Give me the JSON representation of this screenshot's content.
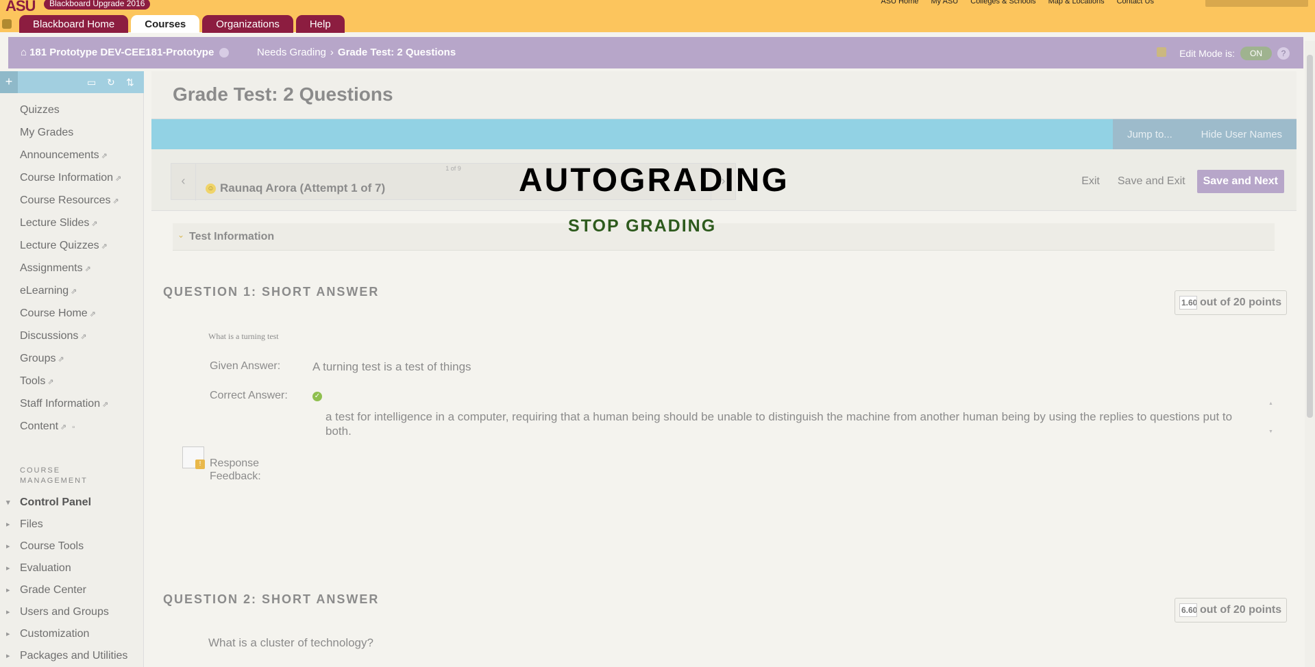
{
  "topbar": {
    "logo": "ASU",
    "badge": "Blackboard Upgrade 2016",
    "links": [
      "ASU Home",
      "My ASU",
      "Colleges & Schools",
      "Map & Locations",
      "Contact Us"
    ],
    "tabs": [
      "Blackboard Home",
      "Courses",
      "Organizations",
      "Help"
    ]
  },
  "coursebar": {
    "course": "181 Prototype DEV-CEE181-Prototype",
    "crumb1": "Needs Grading",
    "crumb_sep": "›",
    "crumb2": "Grade Test: 2 Questions",
    "edit_label": "Edit Mode is:",
    "edit_state": "ON",
    "help": "?"
  },
  "sidebar": {
    "items": [
      "Quizzes",
      "My Grades",
      "Announcements",
      "Course Information",
      "Course Resources",
      "Lecture Slides",
      "Lecture Quizzes",
      "Assignments",
      "eLearning",
      "Course Home",
      "Discussions",
      "Groups",
      "Tools",
      "Staff Information",
      "Content"
    ],
    "management_heading": "COURSE MANAGEMENT",
    "management": [
      "Control Panel",
      "Files",
      "Course Tools",
      "Evaluation",
      "Grade Center",
      "Users and Groups",
      "Customization",
      "Packages and Utilities"
    ]
  },
  "main": {
    "title": "Grade Test: 2 Questions",
    "jump": "Jump to...",
    "hide_names": "Hide User Names",
    "counter": "1 of 9",
    "student": "Raunaq Arora (Attempt 1 of 7)",
    "buttons": {
      "exit": "Exit",
      "save_exit": "Save and Exit",
      "save_next": "Save and Next"
    },
    "overlay_title": "AUTOGRADING",
    "overlay_sub": "STOP GRADING",
    "test_info": "Test Information",
    "q1": {
      "heading": "QUESTION 1:   SHORT ANSWER",
      "score": "1.60",
      "points": "out of 20 points",
      "question": "What is a turning test",
      "given_label": "Given Answer:",
      "given": "A turning test is a test of things",
      "correct_label": "Correct Answer:",
      "correct": "a test for intelligence in a computer, requiring that a human being should be unable to distinguish the machine from another human being by using the replies to questions put to both.",
      "feedback_label": "Response Feedback:"
    },
    "q2": {
      "heading": "QUESTION 2:   SHORT ANSWER",
      "score": "6.60",
      "points": "out of 20 points",
      "question": "What is a cluster of technology?"
    }
  },
  "colors": {
    "asu_maroon": "#8c1d40",
    "asu_gold": "#fcc55d",
    "course_purple": "#b7a6c9",
    "blue_bar": "#92d2e4"
  }
}
